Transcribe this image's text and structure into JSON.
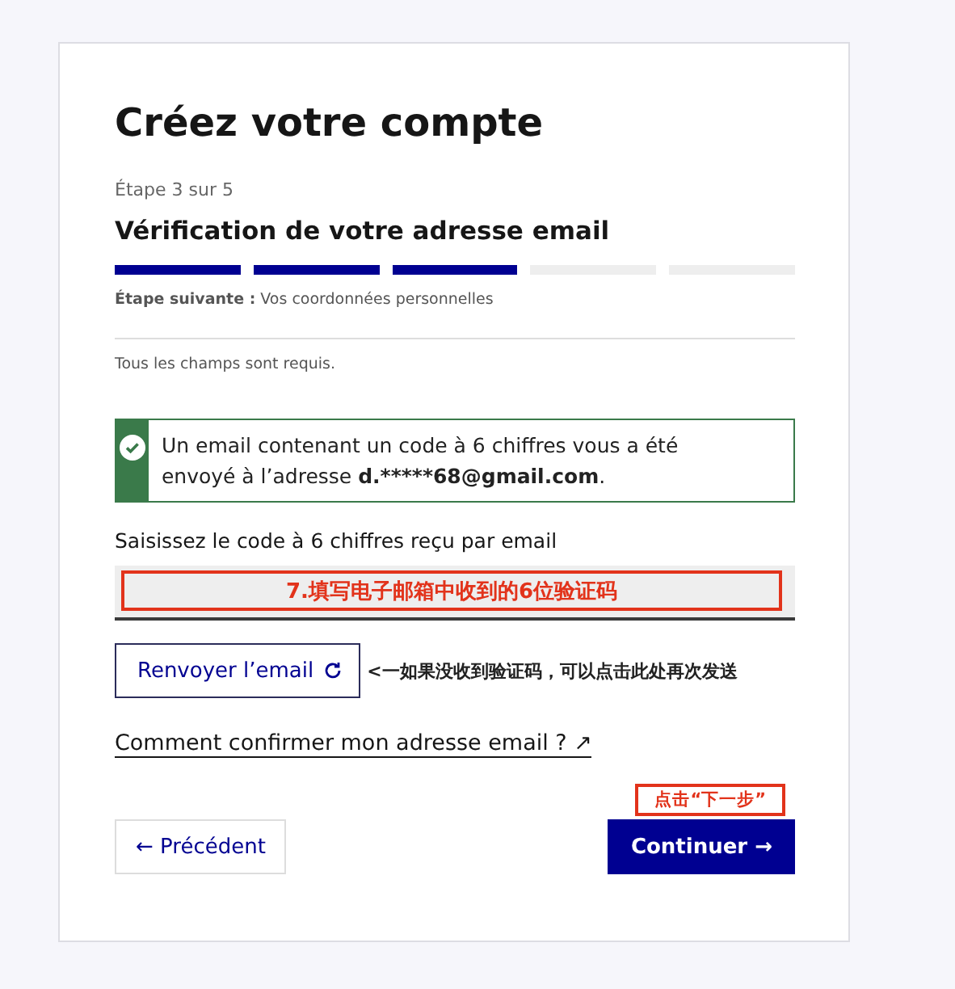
{
  "title": "Créez votre compte",
  "step_label": "Étape 3 sur 5",
  "step_title": "Vérification de votre adresse email",
  "steps": [
    {
      "completed": true
    },
    {
      "completed": true
    },
    {
      "completed": true
    },
    {
      "completed": false
    },
    {
      "completed": false
    }
  ],
  "next_step": "**Étape suivante :** Vos coordonnées personnelles",
  "required_note": "Tous les champs sont requis.",
  "alert": {
    "text": "Un email contenant un code à 6 chiffres vous a été envoyé à l’adresse ",
    "email": "d.*****68@gmail.com",
    "end": "."
  },
  "code_field": {
    "label": "Saisissez le code à 6 chiffres reçu par email",
    "annotation": "7.填写电子邮箱中收到的6位验证码"
  },
  "resend_button": {
    "label": "Renvoyer l’email",
    "annotation": "<一如果没收到验证码，可以点击此处再次发送"
  },
  "help_link": "Comment confirmer mon adresse email ? ↗",
  "back_button": "← Précédent",
  "continue_button": {
    "label": "Continuer →",
    "annotation": "点击“下一步”"
  }
}
